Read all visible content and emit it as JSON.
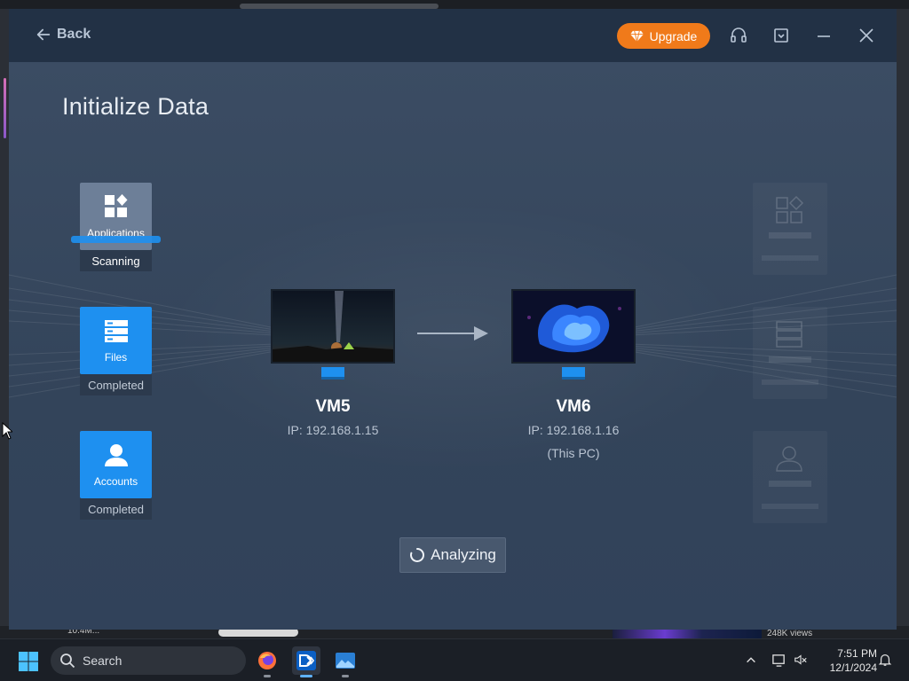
{
  "window": {
    "back_label": "Back",
    "upgrade_label": "Upgrade",
    "page_title": "Initialize Data"
  },
  "categories": [
    {
      "label": "Applications",
      "status": "Scanning"
    },
    {
      "label": "Files",
      "status": "Completed"
    },
    {
      "label": "Accounts",
      "status": "Completed"
    }
  ],
  "source_pc": {
    "name": "VM5",
    "ip": "IP: 192.168.1.15"
  },
  "target_pc": {
    "name": "VM6",
    "ip": "IP: 192.168.1.16",
    "note": "(This PC)"
  },
  "action": {
    "label": "Analyzing"
  },
  "background": {
    "left_text": "10.4M...",
    "right_text": "248K views"
  },
  "taskbar": {
    "search_placeholder": "Search",
    "time": "7:51 PM",
    "date": "12/1/2024"
  },
  "colors": {
    "accent": "#1e90f0",
    "upgrade": "#f07a1a",
    "titlebar": "#223145",
    "content": "#34445a"
  }
}
